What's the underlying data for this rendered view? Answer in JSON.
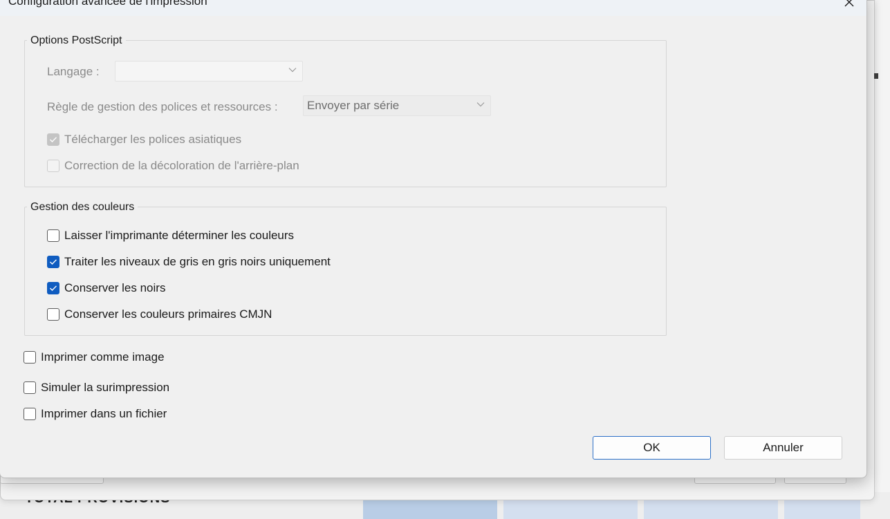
{
  "dialog": {
    "title": "Configuration avancée de l'impression"
  },
  "postscript": {
    "group_label": "Options PostScript",
    "language_label": "Langage :",
    "language_value": "",
    "font_rule_label": "Règle de gestion des polices et ressources :",
    "font_rule_value": "Envoyer par série",
    "download_asian_fonts": {
      "label": "Télécharger les polices asiatiques",
      "checked": true,
      "enabled": false
    },
    "background_correction": {
      "label": "Correction de la décoloration de l'arrière-plan",
      "checked": false,
      "enabled": false
    }
  },
  "color": {
    "group_label": "Gestion des couleurs",
    "options": [
      {
        "label": "Laisser l'imprimante déterminer les couleurs",
        "checked": false
      },
      {
        "label": "Traiter les niveaux de gris en gris noirs uniquement",
        "checked": true
      },
      {
        "label": "Conserver les noirs",
        "checked": true
      },
      {
        "label": "Conserver les couleurs primaires CMJN",
        "checked": false
      }
    ]
  },
  "options": [
    {
      "label": "Imprimer comme image",
      "checked": false
    },
    {
      "label": "Simuler la surimpression",
      "checked": false
    },
    {
      "label": "Imprimer dans un fichier",
      "checked": false
    }
  ],
  "buttons": {
    "ok": "OK",
    "cancel": "Annuler"
  },
  "background": {
    "total_label": "TOTAL PROVISIONS"
  },
  "colors": {
    "accent": "#0f5cc0",
    "primary_button_border": "#2b6fc7"
  }
}
